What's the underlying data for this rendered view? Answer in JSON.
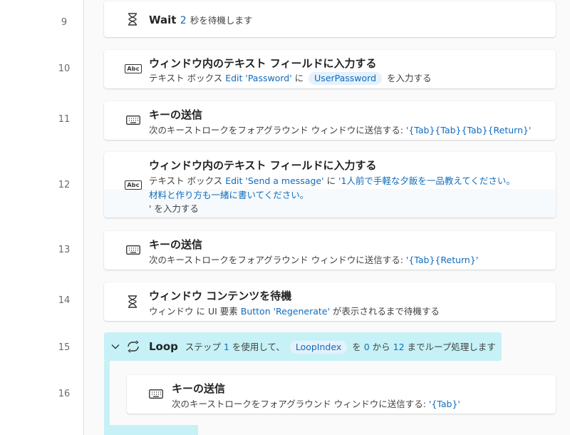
{
  "line_numbers": [
    "9",
    "10",
    "11",
    "12",
    "13",
    "14",
    "15",
    "16"
  ],
  "actions": {
    "wait": {
      "title": "Wait",
      "seconds": "2",
      "suffix": "秒を待機します"
    },
    "input_password": {
      "title": "ウィンドウ内のテキスト フィールドに入力する",
      "prefix": "テキスト ボックス",
      "element": "Edit 'Password'",
      "mid": "に",
      "variable": "UserPassword",
      "suffix": "を入力する"
    },
    "send_keys_1": {
      "title": "キーの送信",
      "prefix": "次のキーストロークをフォアグラウンド ウィンドウに送信する:",
      "keys": "'{Tab}{Tab}{Tab}{Return}'"
    },
    "input_message": {
      "title": "ウィンドウ内のテキスト フィールドに入力する",
      "prefix": "テキスト ボックス",
      "element": "Edit 'Send a message'",
      "mid": "に",
      "text_line1": "'1人前で手軽な夕飯を一品教えてください。",
      "text_line2": "材料と作り方も一緒に書いてください。",
      "text_line3": "' を入力する"
    },
    "send_keys_2": {
      "title": "キーの送信",
      "prefix": "次のキーストロークをフォアグラウンド ウィンドウに送信する:",
      "keys": "'{Tab}{Return}'"
    },
    "wait_window": {
      "title": "ウィンドウ コンテンツを待機",
      "prefix": "ウィンドウ に UI 要素",
      "element": "Button 'Regenerate'",
      "suffix": "が表示されるまで待機する"
    },
    "loop": {
      "title": "Loop",
      "text1": "ステップ",
      "step": "1",
      "text2": "を使用して、",
      "variable": "LoopIndex",
      "text3": "を",
      "start": "0",
      "text4": "から",
      "end": "12",
      "text5": "までループ処理します"
    },
    "send_keys_3": {
      "title": "キーの送信",
      "prefix": "次のキーストロークをフォアグラウンド ウィンドウに送信する:",
      "keys": "'{Tab}'"
    }
  },
  "icons": {
    "wait": "hourglass-icon",
    "input": "abc-textbox-icon",
    "keys": "keyboard-icon",
    "loop": "loop-icon",
    "collapse": "chevron-down-icon"
  },
  "icon_text": {
    "abc": "Abc"
  },
  "colors": {
    "accent": "#0f6cbd",
    "loop_bg": "#c6f2f7",
    "pill_bg": "#e5f1fb"
  }
}
